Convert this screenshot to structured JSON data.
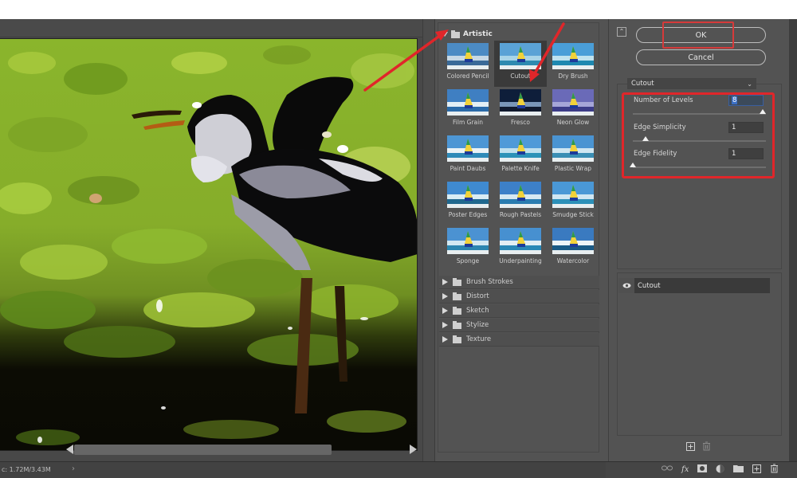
{
  "preview": {
    "status_text": "c: 1.72M/3.43M",
    "status_chevron": "›",
    "scroll_left": "scroll-left",
    "scroll_right": "scroll-right"
  },
  "gallery": {
    "open_category": "Artistic",
    "selected_filter": "Cutout",
    "filters": [
      {
        "label": "Colored Pencil",
        "selected": false
      },
      {
        "label": "Cutout",
        "selected": true
      },
      {
        "label": "Dry Brush",
        "selected": false
      },
      {
        "label": "Film Grain",
        "selected": false
      },
      {
        "label": "Fresco",
        "selected": false
      },
      {
        "label": "Neon Glow",
        "selected": false
      },
      {
        "label": "Paint Daubs",
        "selected": false
      },
      {
        "label": "Palette Knife",
        "selected": false
      },
      {
        "label": "Plastic Wrap",
        "selected": false
      },
      {
        "label": "Poster Edges",
        "selected": false
      },
      {
        "label": "Rough Pastels",
        "selected": false
      },
      {
        "label": "Smudge Stick",
        "selected": false
      },
      {
        "label": "Sponge",
        "selected": false
      },
      {
        "label": "Underpainting",
        "selected": false
      },
      {
        "label": "Watercolor",
        "selected": false
      }
    ],
    "collapsed_categories": [
      "Brush Strokes",
      "Distort",
      "Sketch",
      "Stylize",
      "Texture"
    ]
  },
  "controls": {
    "ok_label": "OK",
    "cancel_label": "Cancel",
    "filter_select_value": "Cutout",
    "params": [
      {
        "label": "Number of Levels",
        "value": "8",
        "slider_fraction": 1.0,
        "active": true
      },
      {
        "label": "Edge Simplicity",
        "value": "1",
        "slider_fraction": 0.1,
        "active": false
      },
      {
        "label": "Edge Fidelity",
        "value": "1",
        "slider_fraction": 0.0,
        "active": false
      }
    ],
    "layers": [
      {
        "name": "Cutout",
        "visible": true
      }
    ]
  },
  "annotations": {
    "highlight_color": "#e0262a",
    "arrow_color": "#e0262a"
  }
}
